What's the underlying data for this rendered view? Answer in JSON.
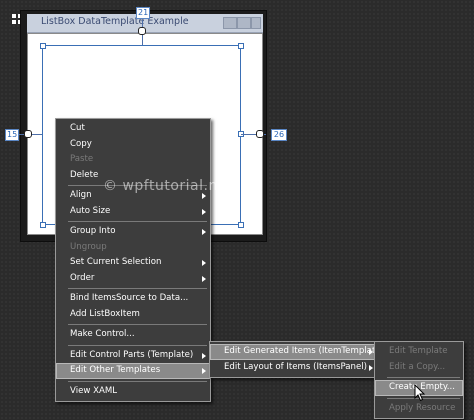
{
  "designer": {
    "window_title": "ListBox DataTemplate Example",
    "margin_top": "21",
    "margin_left": "15",
    "margin_right": "26"
  },
  "watermark": "© wpftutorial.net",
  "context_menu": {
    "items": [
      {
        "label": "Cut",
        "enabled": true
      },
      {
        "label": "Copy",
        "enabled": true
      },
      {
        "label": "Paste",
        "enabled": false
      },
      {
        "label": "Delete",
        "enabled": true
      },
      {
        "label": "Align",
        "enabled": true,
        "submenu": true
      },
      {
        "label": "Auto Size",
        "enabled": true,
        "submenu": true
      },
      {
        "label": "Group Into",
        "enabled": true,
        "submenu": true
      },
      {
        "label": "Ungroup",
        "enabled": false
      },
      {
        "label": "Set Current Selection",
        "enabled": true,
        "submenu": true
      },
      {
        "label": "Order",
        "enabled": true,
        "submenu": true
      },
      {
        "label": "Bind ItemsSource to Data...",
        "enabled": true
      },
      {
        "label": "Add ListBoxItem",
        "enabled": true
      },
      {
        "label": "Make Control...",
        "enabled": true
      },
      {
        "label": "Edit Control Parts (Template)",
        "enabled": true,
        "submenu": true
      },
      {
        "label": "Edit Other Templates",
        "enabled": true,
        "submenu": true,
        "highlighted": true
      },
      {
        "label": "View XAML",
        "enabled": true
      }
    ]
  },
  "submenu_other_templates": {
    "items": [
      {
        "label": "Edit Generated Items (ItemTemplate)",
        "enabled": true,
        "submenu": true,
        "highlighted": true
      },
      {
        "label": "Edit Layout of Items (ItemsPanel)",
        "enabled": true,
        "submenu": true
      }
    ]
  },
  "submenu_item_template": {
    "items": [
      {
        "label": "Edit Template",
        "enabled": false
      },
      {
        "label": "Edit a Copy...",
        "enabled": false
      },
      {
        "label": "Create Empty...",
        "enabled": true,
        "highlighted": true
      },
      {
        "label": "Apply Resource",
        "enabled": false
      }
    ]
  }
}
